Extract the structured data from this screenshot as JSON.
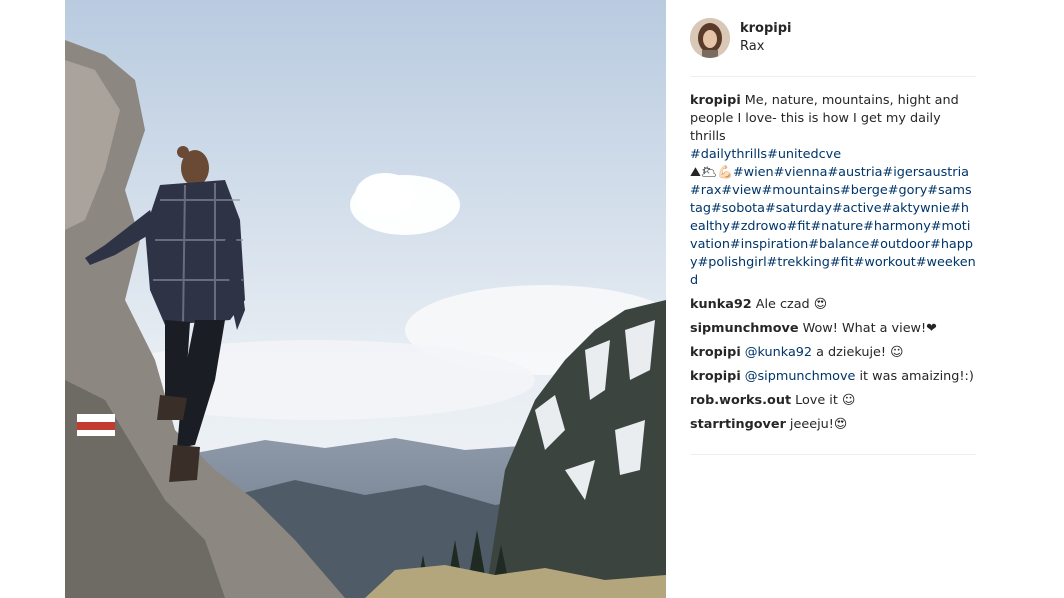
{
  "post": {
    "username": "kropipi",
    "location": "Rax",
    "caption": {
      "author": "kropipi",
      "text": "Me, nature, mountains, hight and people I love- this is how I get my daily thrills",
      "hashtags_line1": "#dailythrills#unitedcve",
      "emoji": "⛰🌥💪🏻",
      "hashtags_rest": "#wien#vienna#austria#igersaustria#rax#view#mountains#berge#gory#samstag#sobota#saturday#active#aktywnie#healthy#zdrowo#fit#nature#harmony#motivation#inspiration#balance#outdoor#happy#polishgirl#trekking#fit#workout#weekend"
    },
    "comments": [
      {
        "author": "kunka92",
        "text": "Ale czad 😍"
      },
      {
        "author": "sipmunchmove",
        "text": "Wow! What a view!❤"
      },
      {
        "author": "kropipi",
        "mention": "@kunka92",
        "text": " a dziekuje! ☺"
      },
      {
        "author": "kropipi",
        "mention": "@sipmunchmove",
        "text": " it was amaizing!:)"
      },
      {
        "author": "rob.works.out",
        "text": "Love it ☺"
      },
      {
        "author": "starrtingover",
        "text": "jeeeju!😍"
      }
    ]
  }
}
